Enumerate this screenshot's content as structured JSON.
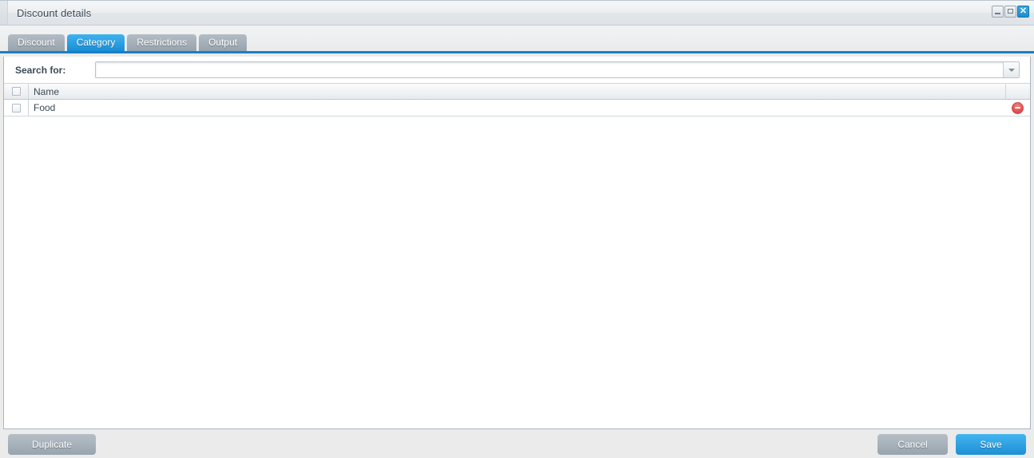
{
  "window": {
    "title": "Discount details",
    "controls": {
      "minimize": "minimize",
      "maximize": "maximize",
      "close": "✕"
    }
  },
  "tabs": [
    {
      "label": "Discount",
      "active": false
    },
    {
      "label": "Category",
      "active": true
    },
    {
      "label": "Restrictions",
      "active": false
    },
    {
      "label": "Output",
      "active": false
    }
  ],
  "search": {
    "label": "Search for:",
    "value": "",
    "placeholder": ""
  },
  "grid": {
    "columns": [
      "Name"
    ],
    "rows": [
      {
        "name": "Food",
        "checked": false,
        "action": "remove"
      }
    ]
  },
  "footer": {
    "duplicate_label": "Duplicate",
    "cancel_label": "Cancel",
    "save_label": "Save"
  },
  "colors": {
    "accent": "#1a8ed6",
    "tab_inactive": "#97a3ad",
    "underline": "#1a7fc4",
    "delete": "#e35656",
    "footer_bg": "#ebebeb"
  }
}
